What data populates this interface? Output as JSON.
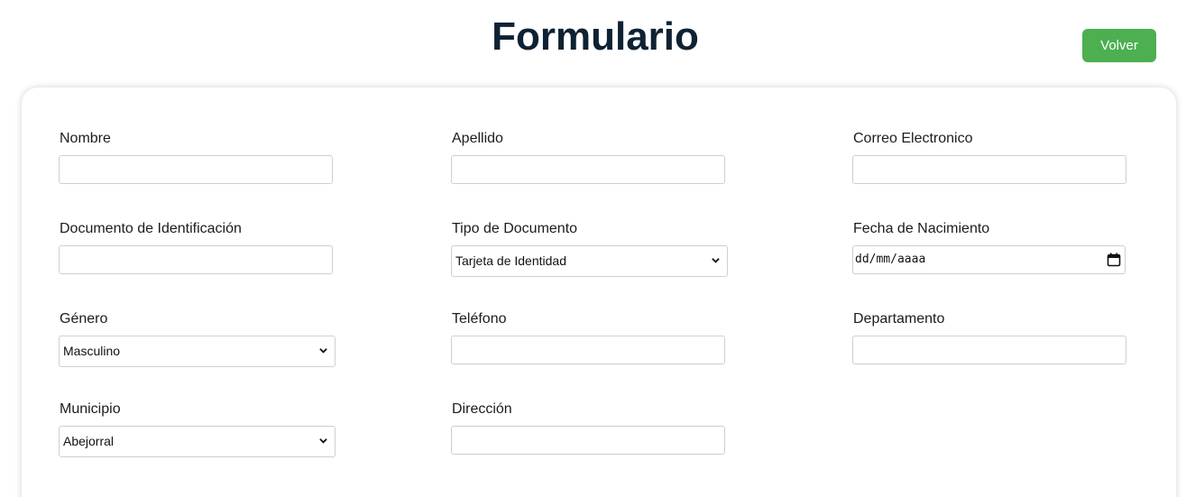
{
  "header": {
    "title": "Formulario",
    "back_label": "Volver"
  },
  "form": {
    "nombre": {
      "label": "Nombre",
      "value": ""
    },
    "apellido": {
      "label": "Apellido",
      "value": ""
    },
    "correo": {
      "label": "Correo Electronico",
      "value": ""
    },
    "documento": {
      "label": "Documento de Identificación",
      "value": ""
    },
    "tipo_documento": {
      "label": "Tipo de Documento",
      "selected": "Tarjeta de Identidad"
    },
    "fecha_nacimiento": {
      "label": "Fecha de Nacimiento",
      "placeholder": "dd/mm/aaaa"
    },
    "genero": {
      "label": "Género",
      "selected": "Masculino"
    },
    "telefono": {
      "label": "Teléfono",
      "value": ""
    },
    "departamento": {
      "label": "Departamento",
      "value": ""
    },
    "municipio": {
      "label": "Municipio",
      "selected": "Abejorral"
    },
    "direccion": {
      "label": "Dirección",
      "value": ""
    }
  },
  "colors": {
    "title": "#0e2233",
    "back_button": "#4caf50"
  },
  "icons": {
    "select_arrow": "chevron-down-icon",
    "date_picker": "calendar-icon"
  }
}
